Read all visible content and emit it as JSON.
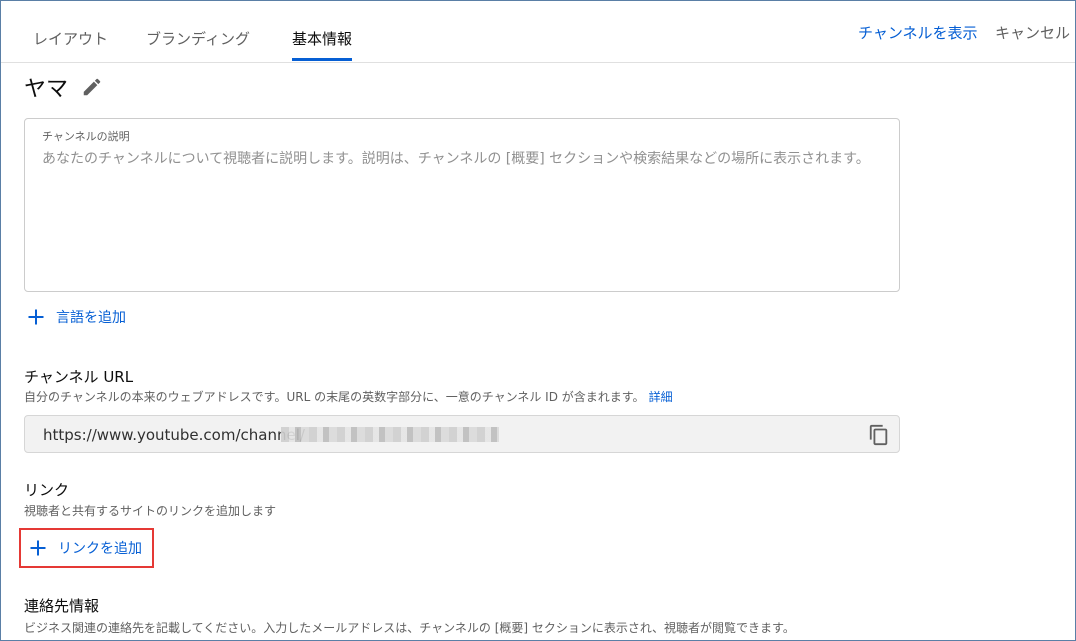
{
  "tabs": [
    {
      "label": "レイアウト",
      "active": false
    },
    {
      "label": "ブランディング",
      "active": false
    },
    {
      "label": "基本情報",
      "active": true
    }
  ],
  "header": {
    "view_channel": "チャンネルを表示",
    "cancel": "キャンセル"
  },
  "channel": {
    "name": "ヤマ"
  },
  "description": {
    "label": "チャンネルの説明",
    "placeholder": "あなたのチャンネルについて視聴者に説明します。説明は、チャンネルの [概要] セクションや検索結果などの場所に表示されます。"
  },
  "add_language": {
    "label": "言語を追加"
  },
  "channel_url": {
    "title": "チャンネル URL",
    "description": "自分のチャンネルの本来のウェブアドレスです。URL の末尾の英数字部分に、一意のチャンネル ID が含まれます。",
    "more_link": "詳細",
    "value": "https://www.youtube.com/channel/"
  },
  "links": {
    "title": "リンク",
    "description": "視聴者と共有するサイトのリンクを追加します",
    "add_label": "リンクを追加"
  },
  "contact": {
    "title": "連絡先情報",
    "description": "ビジネス関連の連絡先を記載してください。入力したメールアドレスは、チャンネルの [概要] セクションに表示され、視聴者が閲覧できます。"
  },
  "colors": {
    "accent": "#065fd4",
    "highlight_border": "#e53935"
  }
}
